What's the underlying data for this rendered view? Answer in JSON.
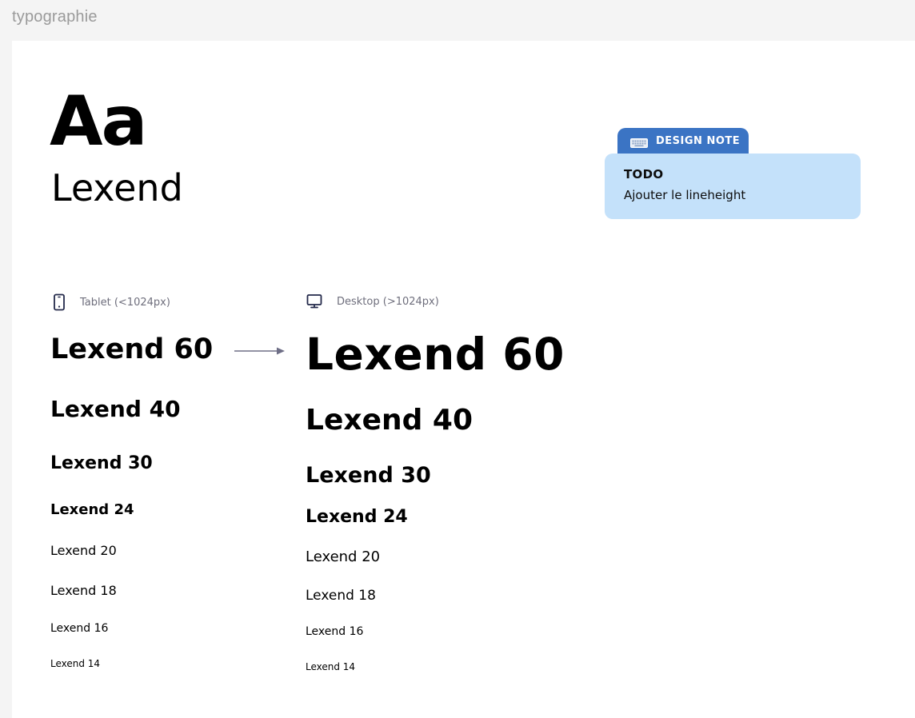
{
  "frame": {
    "title": "typographie"
  },
  "hero": {
    "glyphs": "Aa",
    "font_name": "Lexend"
  },
  "design_note": {
    "tab_label": "DESIGN NOTE",
    "icon": "keyboard-icon",
    "heading": "TODO",
    "text": "Ajouter le lineheight",
    "colors": {
      "tab": "#3b74c4",
      "body": "#c4e1fa"
    }
  },
  "columns": {
    "tablet": {
      "icon": "smartphone-icon",
      "label": "Tablet (<1024px)",
      "samples": [
        "Lexend 60",
        "Lexend 40",
        "Lexend 30",
        "Lexend 24",
        "Lexend 20",
        "Lexend 18",
        "Lexend 16",
        "Lexend 14"
      ]
    },
    "desktop": {
      "icon": "monitor-icon",
      "label": "Desktop (>1024px)",
      "samples": [
        "Lexend 60",
        "Lexend 40",
        "Lexend 30",
        "Lexend 24",
        "Lexend 20",
        "Lexend 18",
        "Lexend 16",
        "Lexend 14"
      ]
    }
  }
}
